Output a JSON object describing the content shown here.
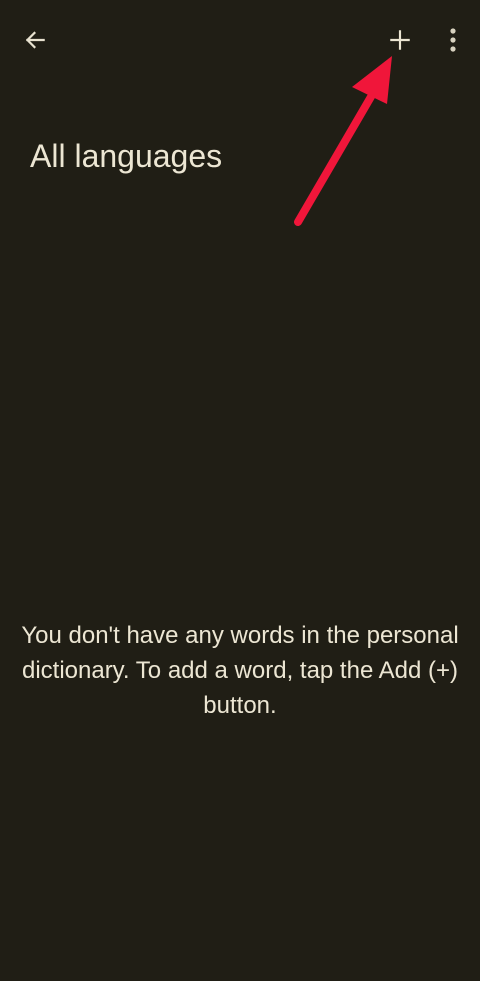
{
  "app_bar": {
    "back_icon": "arrow-left-icon",
    "add_icon": "plus-icon",
    "more_icon": "more-vertical-icon"
  },
  "page": {
    "title": "All languages"
  },
  "empty_state": {
    "message": "You don't have any words in the personal dictionary. To add a word, tap the Add (+) button."
  },
  "annotation": {
    "arrow_color": "#f0163a",
    "points_to": "add-button"
  },
  "colors": {
    "background": "#201e15",
    "text": "#ece6d3"
  }
}
